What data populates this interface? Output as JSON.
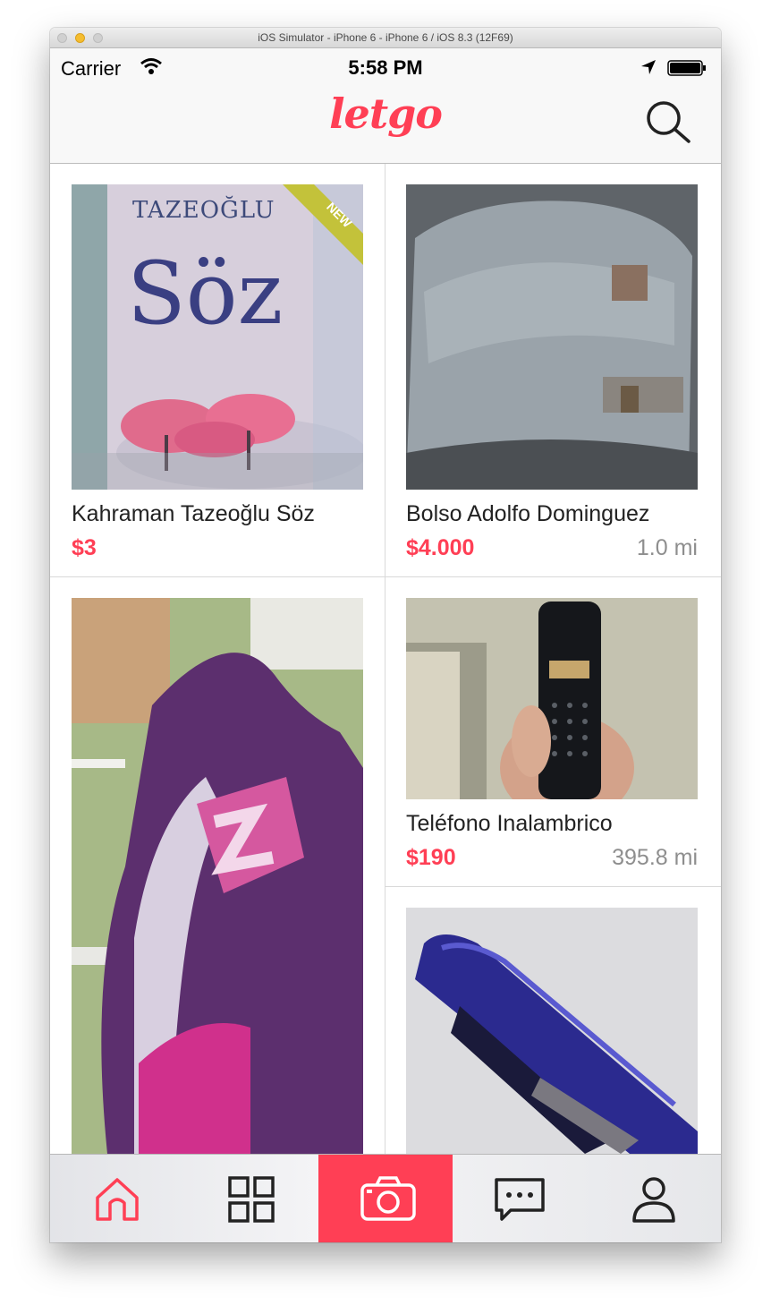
{
  "window": {
    "title": "iOS Simulator - iPhone 6 - iPhone 6 / iOS 8.3 (12F69)"
  },
  "status_bar": {
    "carrier": "Carrier",
    "time": "5:58 PM"
  },
  "nav": {
    "logo": "letgo",
    "search_icon": "search-icon"
  },
  "listings": [
    {
      "title": "Kahraman Tazeoğlu Söz",
      "price": "$3",
      "distance": "",
      "badge": "NEW",
      "cover_title": "Söz",
      "cover_author": "TAZEOĞLU"
    },
    {
      "title": "Bolso Adolfo Dominguez",
      "price": "$4.000",
      "distance": "1.0 mi"
    },
    {
      "title": "",
      "price": "",
      "distance": ""
    },
    {
      "title": "Teléfono Inalambrico",
      "price": "$190",
      "distance": "395.8 mi"
    },
    {
      "title": "",
      "price": "",
      "distance": ""
    }
  ],
  "tabs": [
    {
      "name": "home",
      "icon": "home-icon",
      "active": true
    },
    {
      "name": "categories",
      "icon": "grid-icon"
    },
    {
      "name": "sell",
      "icon": "camera-icon"
    },
    {
      "name": "chats",
      "icon": "chat-icon"
    },
    {
      "name": "profile",
      "icon": "profile-icon"
    }
  ],
  "colors": {
    "accent": "#ff3f55",
    "badge": "#c3c23a",
    "text": "#222222",
    "muted": "#8e8e8e"
  }
}
